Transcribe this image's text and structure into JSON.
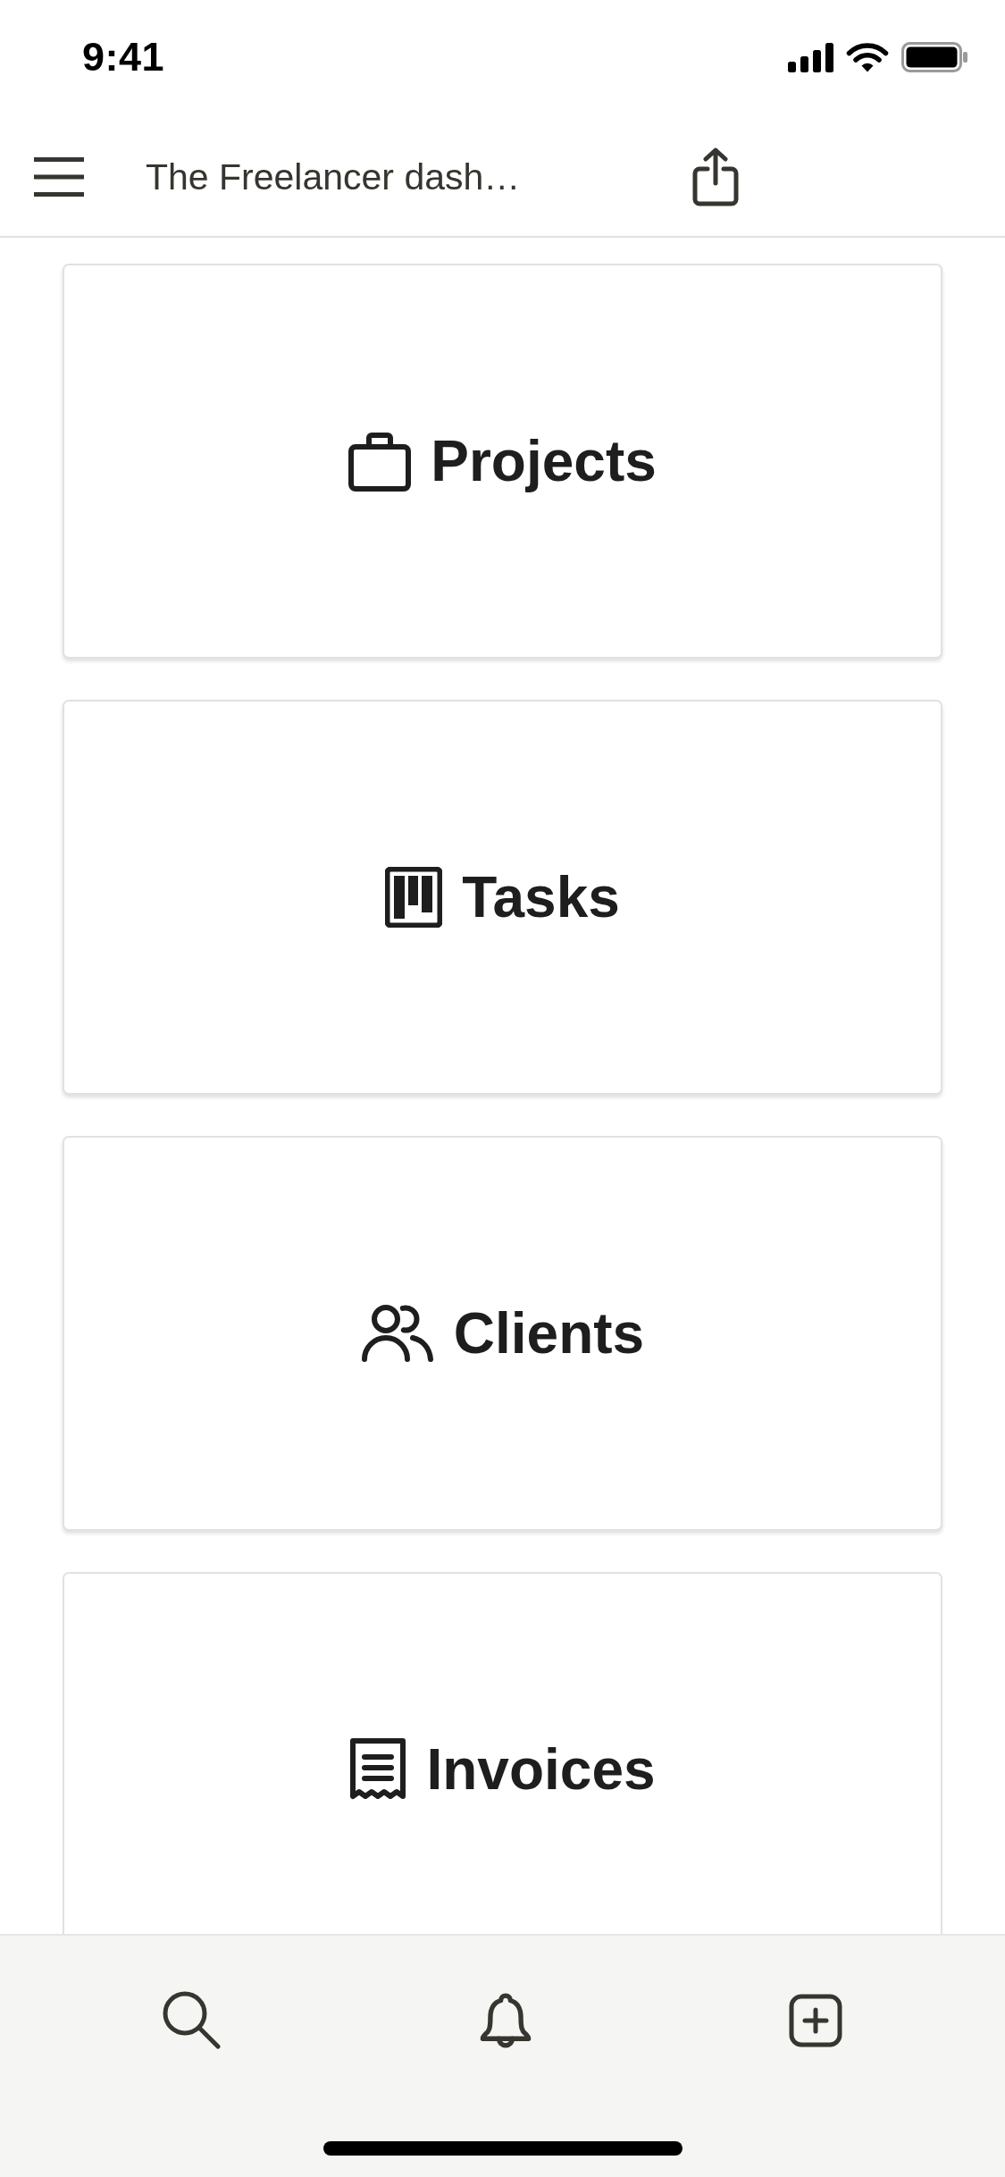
{
  "status_bar": {
    "time": "9:41"
  },
  "header": {
    "title": "The Freelancer dash…"
  },
  "cards": [
    {
      "label": "Projects"
    },
    {
      "label": "Tasks"
    },
    {
      "label": "Clients"
    },
    {
      "label": "Invoices"
    }
  ]
}
